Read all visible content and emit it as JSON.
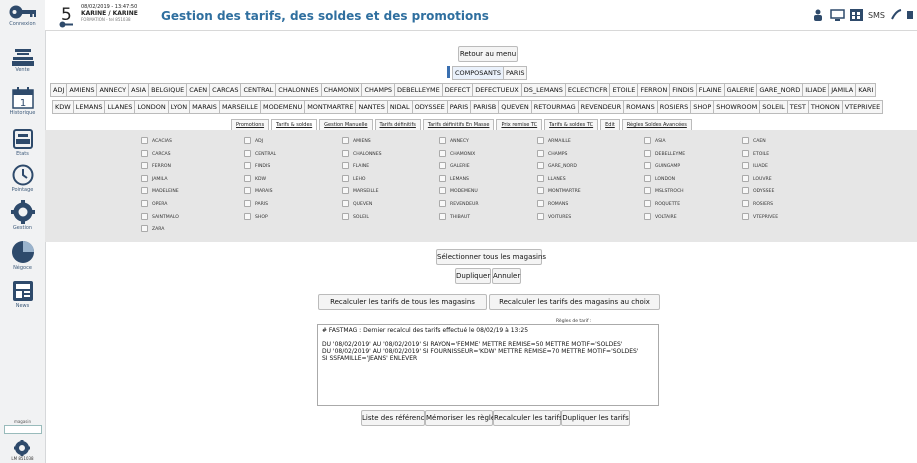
{
  "sidebar": {
    "items": [
      {
        "label": "Connexion",
        "icon": "key-icon"
      },
      {
        "label": "Vente",
        "icon": "cash-register-icon"
      },
      {
        "label": "Historique",
        "icon": "calendar-icon",
        "day": "1"
      },
      {
        "label": "Etats",
        "icon": "printer-icon"
      },
      {
        "label": "Pointage",
        "icon": "clock-icon"
      },
      {
        "label": "Gestion",
        "icon": "gear-icon"
      },
      {
        "label": "Négoce",
        "icon": "pie-chart-icon"
      },
      {
        "label": "News",
        "icon": "newspaper-icon"
      }
    ],
    "bottom_label": "magasin",
    "bottom_code": "LM 851038"
  },
  "header": {
    "count": "5",
    "date": "08/02/2019 - 13:47:50",
    "user": "KARINE / KARINE",
    "subtitle": "FORMATION - tel 851038",
    "title": "Gestion des tarifs, des soldes et des promotions",
    "sms_label": "SMS"
  },
  "main": {
    "back_button": "Retour au menu",
    "scope_tabs": [
      "COMPOSANTS",
      "PARIS"
    ],
    "store_buttons_row1": [
      "ADJ",
      "AMIENS",
      "ANNECY",
      "ASIA",
      "BELGIQUE",
      "CAEN",
      "CARCAS",
      "CENTRAL",
      "CHALONNES",
      "CHAMONIX",
      "CHAMPS",
      "DEBELLEYME",
      "DEFECT",
      "DEFECTUEUX",
      "DS_LEMANS",
      "ECLECTICFR",
      "ETOILE",
      "FERRON",
      "FINDIS",
      "FLAINE",
      "GALERIE",
      "GARE_NORD",
      "ILIADE",
      "JAMILA",
      "KARI"
    ],
    "store_buttons_row2": [
      "KDW",
      "LEMANS",
      "LLANES",
      "LONDON",
      "LYON",
      "MARAIS",
      "MARSEILLE",
      "MODEMENU",
      "MONTMARTRE",
      "NANTES",
      "NIDAL",
      "ODYSSEE",
      "PARIS",
      "PARISB",
      "QUEVEN",
      "RETOURMAG",
      "REVENDEUR",
      "ROMANS",
      "ROSIERS",
      "SHOP",
      "SHOWROOM",
      "SOLEIL",
      "TEST",
      "THONON",
      "VTEPRIVEE"
    ],
    "tabs": [
      "Promotions",
      "Tarifs & soldes",
      "Gestion Manuelle",
      "Tarifs définitifs",
      "Tarifs définitifs En Masse",
      "Prix remise TC",
      "Tarifs & soldes TC",
      "Edit",
      "Règles Soldes Avancées"
    ],
    "active_tab_index": 1,
    "stores_grid": [
      [
        "ACACIAS",
        "ADJ",
        "AMIENS",
        "ANNECY",
        "ARMAILLE",
        "ASIA",
        "CAEN"
      ],
      [
        "CARCAS",
        "CENTRAL",
        "CHALONNES",
        "CHAMONIX",
        "CHAMPS",
        "DEBELLEYME",
        "ETOILE"
      ],
      [
        "FERRON",
        "FINDIS",
        "FLAINE",
        "GALERIE",
        "GARE_NORD",
        "GUINGAMP",
        "ILIADE"
      ],
      [
        "JAMILA",
        "KDW",
        "LEHO",
        "LEMANS",
        "LLANES",
        "LONDON",
        "LOUVRE"
      ],
      [
        "MADELEINE",
        "MARAIS",
        "MARSEILLE",
        "MODEMENU",
        "MONTMARTRE",
        "MSLSTROCH",
        "ODYSSEE"
      ],
      [
        "OPERA",
        "PARIS",
        "QUEVEN",
        "REVENDEUR",
        "ROMANS",
        "ROQUETTE",
        "ROSIERS"
      ],
      [
        "SAINTMALO",
        "SHOP",
        "SOLEIL",
        "THIBAUT",
        "VOITURES",
        "VOLTAIRE",
        "VTEPRIVEE"
      ],
      [
        "ZARA"
      ]
    ],
    "select_all_button": "Sélectionner tous les magasins",
    "duplicate_button": "Dupliquer",
    "cancel_button": "Annuler",
    "recalc_all_button": "Recalculer les tarifs de tous les magasins",
    "recalc_choice_button": "Recalculer les tarifs des magasins au choix",
    "rules_label": "Règles de tarif :",
    "rules_first_line": "# FASTMAG : Dernier recalcul des tarifs effectué le 08/02/19 à 13:25",
    "rules_text": "DU '08/02/2019' AU '08/02/2019' SI RAYON='FEMME' METTRE REMISE=50 METTRE MOTIF='SOLDES'\nDU '08/02/2019' AU '08/02/2019' SI FOURNISSEUR='KDW' METTRE REMISE=70 METTRE MOTIF='SOLDES'\nSI SSFAMILLE='JEANS' ENLEVER",
    "bottom_buttons": [
      "Liste des références",
      "Mémoriser les règles",
      "Recalculer les tarifs",
      "Dupliquer les tarifs"
    ]
  },
  "colors": {
    "title": "#2f6f9f",
    "sidebar_icon": "#2e4a6b",
    "panel_bg": "#e6e6e6"
  }
}
